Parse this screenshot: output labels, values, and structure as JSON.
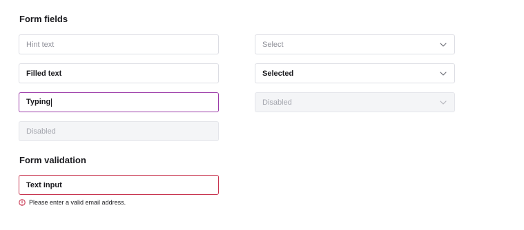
{
  "form_fields": {
    "title": "Form fields",
    "inputs": [
      {
        "state": "hint",
        "text": "Hint text"
      },
      {
        "state": "filled",
        "text": "Filled text"
      },
      {
        "state": "typing",
        "text": "Typing"
      },
      {
        "state": "disabled",
        "text": "Disabled"
      }
    ],
    "selects": [
      {
        "state": "placeholder",
        "text": "Select",
        "chevron_icon": "chevron-down-icon"
      },
      {
        "state": "selected",
        "text": "Selected",
        "chevron_icon": "chevron-down-icon"
      },
      {
        "state": "disabled",
        "text": "Disabled",
        "chevron_icon": "chevron-down-icon"
      }
    ]
  },
  "form_validation": {
    "title": "Form validation",
    "input_text": "Text input",
    "error_message": "Please enter a valid email address.",
    "error_icon": "alert-circle-icon"
  },
  "colors": {
    "focus_border": "#9b3aa8",
    "error_border": "#c8344f",
    "disabled_bg": "#f4f5f7",
    "field_border": "#dcdde3"
  }
}
